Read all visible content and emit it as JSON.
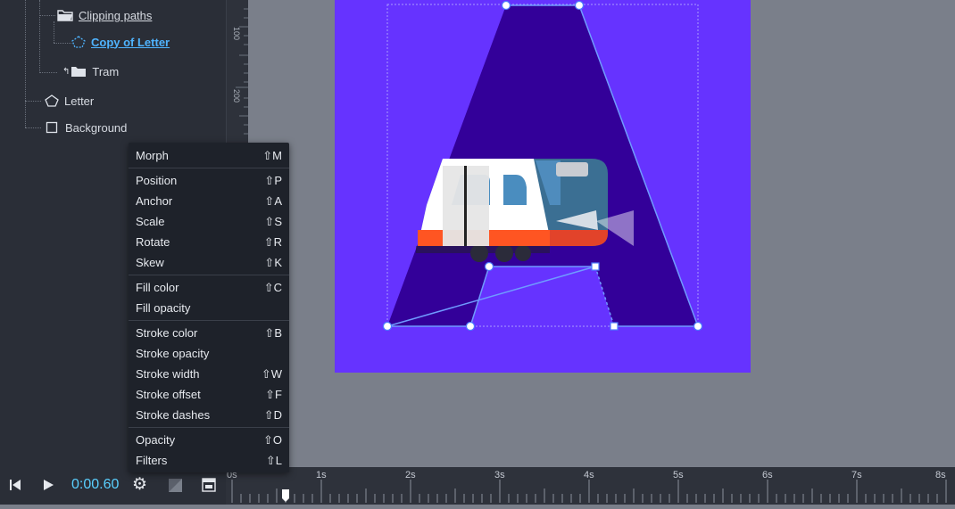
{
  "layers": {
    "clipping_paths": "Clipping paths",
    "copy_of_letter": "Copy of Letter",
    "tram": "Tram",
    "letter": "Letter",
    "background": "Background"
  },
  "ruler": {
    "mark_100": "100",
    "mark_200": "200"
  },
  "menu": {
    "morph": "Morph",
    "morph_key": "⇧M",
    "position": "Position",
    "position_key": "⇧P",
    "anchor": "Anchor",
    "anchor_key": "⇧A",
    "scale": "Scale",
    "scale_key": "⇧S",
    "rotate": "Rotate",
    "rotate_key": "⇧R",
    "skew": "Skew",
    "skew_key": "⇧K",
    "fill_color": "Fill color",
    "fill_color_key": "⇧C",
    "fill_opacity": "Fill opacity",
    "stroke_color": "Stroke color",
    "stroke_color_key": "⇧B",
    "stroke_opacity": "Stroke opacity",
    "stroke_width": "Stroke width",
    "stroke_width_key": "⇧W",
    "stroke_offset": "Stroke offset",
    "stroke_offset_key": "⇧F",
    "stroke_dashes": "Stroke dashes",
    "stroke_dashes_key": "⇧D",
    "opacity": "Opacity",
    "opacity_key": "⇧O",
    "filters": "Filters",
    "filters_key": "⇧L"
  },
  "playback": {
    "time": "0:00.60",
    "playhead_seconds": 0.6
  },
  "timeline": {
    "labels": [
      "0s",
      "1s",
      "2s",
      "3s",
      "4s",
      "5s",
      "6s",
      "7s",
      "8s"
    ]
  },
  "colors": {
    "artboard": "#6633ff",
    "letter_fill": "#330099",
    "selection": "#6f9bff",
    "accent_text": "#4fb4ff",
    "time_text": "#5ad0ff"
  }
}
